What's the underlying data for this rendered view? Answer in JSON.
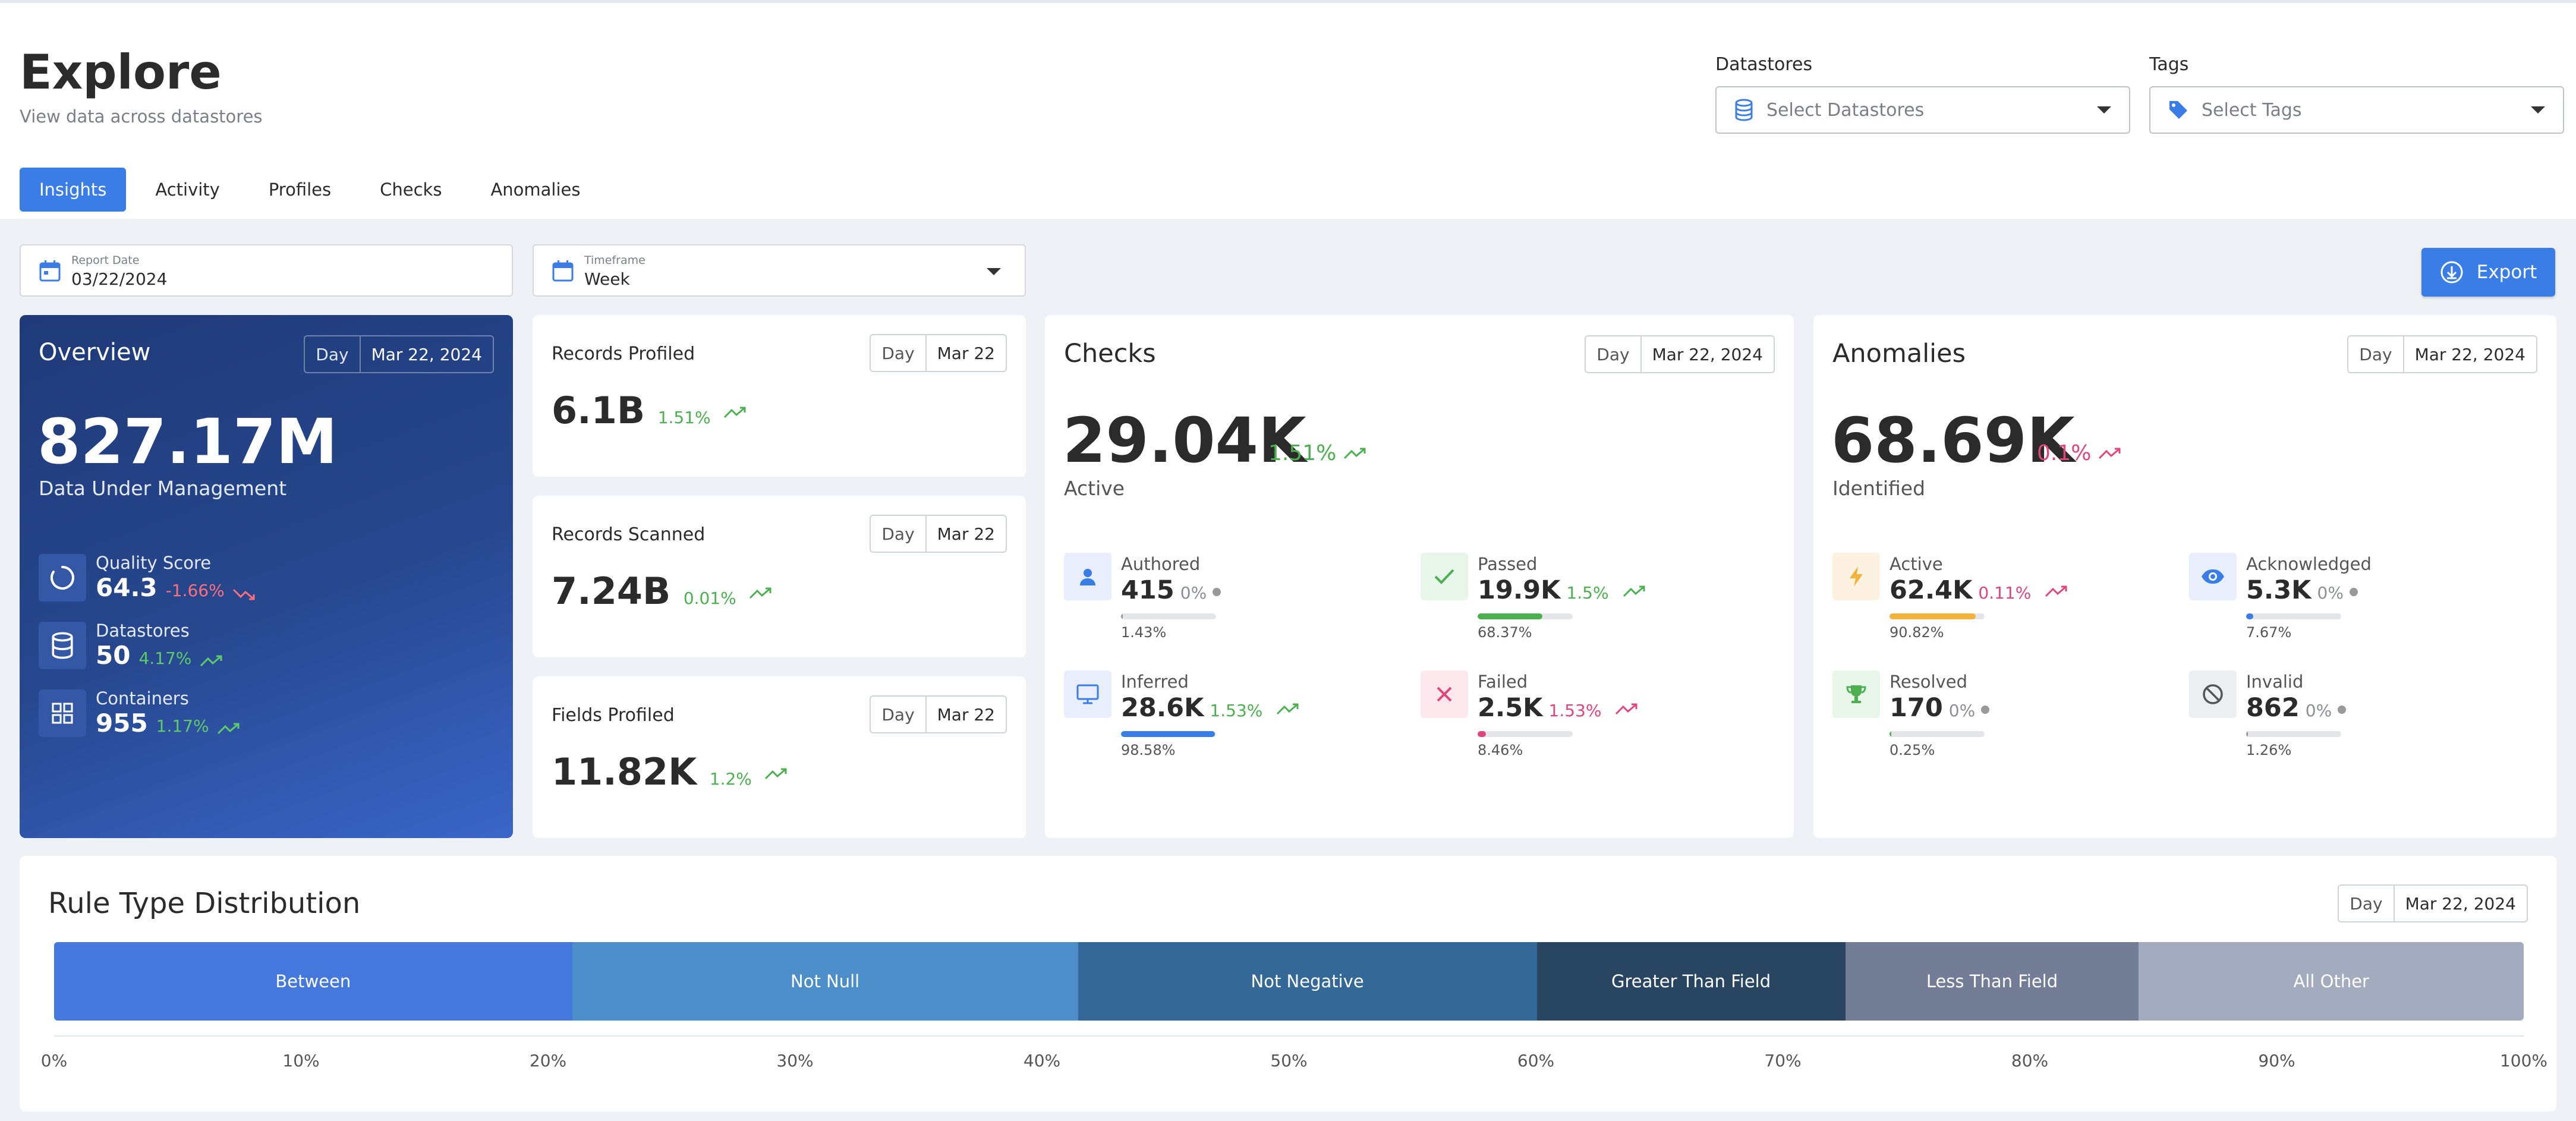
{
  "header": {
    "title": "Explore",
    "subtitle": "View data across datastores",
    "datastores_label": "Datastores",
    "datastores_placeholder": "Select Datastores",
    "tags_label": "Tags",
    "tags_placeholder": "Select Tags"
  },
  "tabs": [
    "Insights",
    "Activity",
    "Profiles",
    "Checks",
    "Anomalies"
  ],
  "active_tab": "Insights",
  "filters": {
    "report_date_label": "Report Date",
    "report_date": "03/22/2024",
    "timeframe_label": "Timeframe",
    "timeframe": "Week",
    "export_label": "Export"
  },
  "overview": {
    "title": "Overview",
    "period": "Day",
    "date": "Mar 22, 2024",
    "value": "827.17M",
    "sublabel": "Data Under Management",
    "rows": [
      {
        "label": "Quality Score",
        "value": "64.3",
        "change": "-1.66%",
        "trend": "down"
      },
      {
        "label": "Datastores",
        "value": "50",
        "change": "4.17%",
        "trend": "up"
      },
      {
        "label": "Containers",
        "value": "955",
        "change": "1.17%",
        "trend": "up"
      }
    ]
  },
  "stats": [
    {
      "title": "Records Profiled",
      "period": "Day",
      "date": "Mar 22",
      "value": "6.1B",
      "change": "1.51%"
    },
    {
      "title": "Records Scanned",
      "period": "Day",
      "date": "Mar 22",
      "value": "7.24B",
      "change": "0.01%"
    },
    {
      "title": "Fields Profiled",
      "period": "Day",
      "date": "Mar 22",
      "value": "11.82K",
      "change": "1.2%"
    }
  ],
  "checks": {
    "title": "Checks",
    "period": "Day",
    "date": "Mar 22, 2024",
    "value": "29.04K",
    "change": "1.51%",
    "sublabel": "Active",
    "metrics": [
      {
        "label": "Authored",
        "value": "415",
        "change": "0%",
        "bar_pct": "1.43%",
        "fraction": 0.0143,
        "color": "#999999"
      },
      {
        "label": "Passed",
        "value": "19.9K",
        "change": "1.5%",
        "bar_pct": "68.37%",
        "fraction": 0.6837,
        "color": "#4caf50"
      },
      {
        "label": "Inferred",
        "value": "28.6K",
        "change": "1.53%",
        "bar_pct": "98.58%",
        "fraction": 0.9858,
        "color": "#3b7de6"
      },
      {
        "label": "Failed",
        "value": "2.5K",
        "change": "1.53%",
        "bar_pct": "8.46%",
        "fraction": 0.0846,
        "color": "#e0457b"
      }
    ]
  },
  "anomalies": {
    "title": "Anomalies",
    "period": "Day",
    "date": "Mar 22, 2024",
    "value": "68.69K",
    "change": "0.1%",
    "sublabel": "Identified",
    "metrics": [
      {
        "label": "Active",
        "value": "62.4K",
        "change": "0.11%",
        "bar_pct": "90.82%",
        "fraction": 0.9082,
        "color": "#f2b33d"
      },
      {
        "label": "Acknowledged",
        "value": "5.3K",
        "change": "0%",
        "bar_pct": "7.67%",
        "fraction": 0.0767,
        "color": "#3b7de6"
      },
      {
        "label": "Resolved",
        "value": "170",
        "change": "0%",
        "bar_pct": "0.25%",
        "fraction": 0.0025,
        "color": "#4caf50"
      },
      {
        "label": "Invalid",
        "value": "862",
        "change": "0%",
        "bar_pct": "1.26%",
        "fraction": 0.0126,
        "color": "#999999"
      }
    ]
  },
  "rule_type": {
    "title": "Rule Type Distribution",
    "period": "Day",
    "date": "Mar 22, 2024"
  },
  "chart_data": {
    "type": "bar",
    "orientation": "horizontal-stacked",
    "categories": [
      "Between",
      "Not Null",
      "Not Negative",
      "Greater Than Field",
      "Less Than Field",
      "All Other"
    ],
    "values": [
      21,
      20.5,
      18.6,
      12.5,
      11.9,
      15.6
    ],
    "colors": [
      "#4478dc",
      "#4b8ec9",
      "#346896",
      "#284561",
      "#737d96",
      "#a3abbf"
    ],
    "xlim": [
      0,
      100
    ],
    "ticks": [
      "0%",
      "10%",
      "20%",
      "30%",
      "40%",
      "50%",
      "60%",
      "70%",
      "80%",
      "90%",
      "100%"
    ]
  }
}
